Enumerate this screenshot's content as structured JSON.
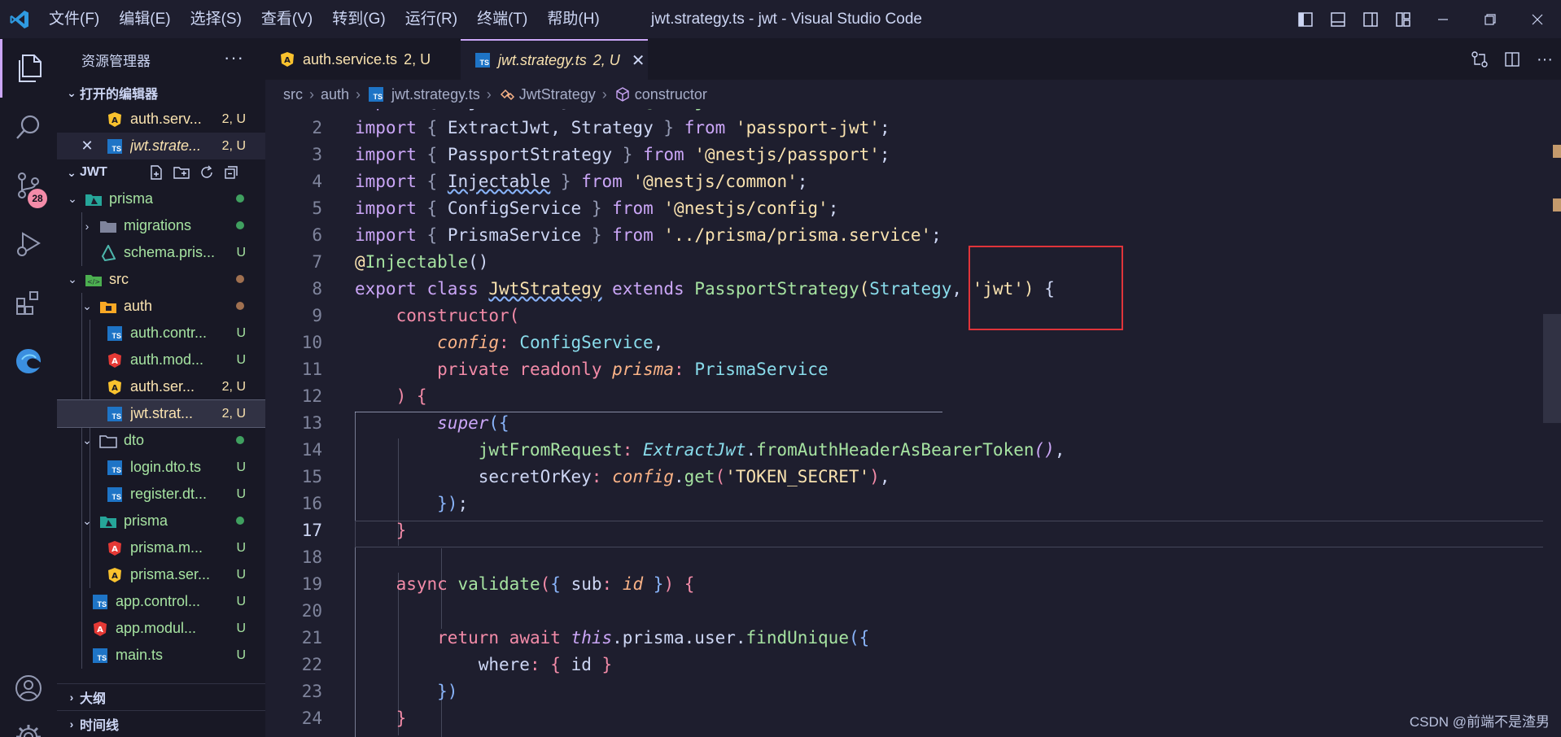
{
  "window": {
    "title": "jwt.strategy.ts - jwt - Visual Studio Code",
    "menus": [
      "文件(F)",
      "编辑(E)",
      "选择(S)",
      "查看(V)",
      "转到(G)",
      "运行(R)",
      "终端(T)",
      "帮助(H)"
    ]
  },
  "activity": {
    "scm_badge": "28"
  },
  "sidebar": {
    "title": "资源管理器",
    "open_editors_title": "打开的编辑器",
    "open_editors": [
      {
        "name": "auth.serv...",
        "status": "2, U"
      },
      {
        "name": "jwt.strate...",
        "status": "2, U"
      }
    ],
    "workspace_title": "JWT",
    "tree": [
      {
        "name": "prisma",
        "status": ""
      },
      {
        "name": "migrations",
        "status": ""
      },
      {
        "name": "schema.pris...",
        "status": "U"
      },
      {
        "name": "src",
        "status": ""
      },
      {
        "name": "auth",
        "status": ""
      },
      {
        "name": "auth.contr...",
        "status": "U"
      },
      {
        "name": "auth.mod...",
        "status": "U"
      },
      {
        "name": "auth.ser...",
        "status": "2, U"
      },
      {
        "name": "jwt.strat...",
        "status": "2, U"
      },
      {
        "name": "dto",
        "status": ""
      },
      {
        "name": "login.dto.ts",
        "status": "U"
      },
      {
        "name": "register.dt...",
        "status": "U"
      },
      {
        "name": "prisma",
        "status": ""
      },
      {
        "name": "prisma.m...",
        "status": "U"
      },
      {
        "name": "prisma.ser...",
        "status": "U"
      },
      {
        "name": "app.control...",
        "status": "U"
      },
      {
        "name": "app.modul...",
        "status": "U"
      },
      {
        "name": "main.ts",
        "status": "U"
      }
    ],
    "outline_title": "大纲",
    "timeline_title": "时间线"
  },
  "tabs": [
    {
      "name": "auth.service.ts",
      "status": "2, U"
    },
    {
      "name": "jwt.strategy.ts",
      "status": "2, U"
    }
  ],
  "breadcrumb": [
    "src",
    "auth",
    "jwt.strategy.ts",
    "JwtStrategy",
    "constructor"
  ],
  "editor": {
    "current_line": 17
  },
  "watermark": "CSDN @前端不是渣男"
}
